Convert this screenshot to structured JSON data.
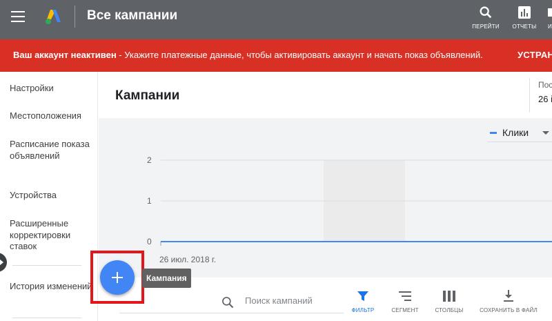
{
  "header": {
    "title": "Все кампании",
    "search_label": "ПЕРЕЙТИ",
    "reports_label": "ОТЧЕТЫ",
    "more_label": "И"
  },
  "banner": {
    "bold_text": "Ваш аккаунт неактивен",
    "message": " - Укажите платежные данные, чтобы активировать аккаунт и начать показ объявлений.",
    "action": "УСТРАН"
  },
  "sidebar": {
    "items": [
      {
        "label": "Настройки"
      },
      {
        "label": "Местоположения"
      },
      {
        "label": "Расписание показа объявлений"
      },
      {
        "label": "Устройства"
      },
      {
        "label": "Расширенные корректировки ставок"
      },
      {
        "label": "История изменений"
      }
    ]
  },
  "main": {
    "title": "Кампании",
    "date_label": "Пос",
    "date_value": "26 і"
  },
  "chart_data": {
    "type": "line",
    "metric": "Клики",
    "yticks": [
      "2",
      "1",
      "0"
    ],
    "ylim": [
      0,
      2
    ],
    "x": [
      "26 июл. 2018 г."
    ],
    "series": [
      {
        "name": "Клики",
        "values": [
          0
        ]
      }
    ],
    "grid": true,
    "color": "#4285f4"
  },
  "fab": {
    "tooltip": "Кампания"
  },
  "toolbar": {
    "search_placeholder": "Поиск кампаний",
    "filter_label": "ФИЛЬТР",
    "segment_label": "СЕГМЕНТ",
    "columns_label": "СТОЛБЦЫ",
    "download_label": "СОХРАНИТЬ В ФАЙЛ"
  },
  "colors": {
    "header": "#5f6368",
    "banner": "#d93025",
    "accent": "#4285f4",
    "highlight": "#e3161b"
  }
}
